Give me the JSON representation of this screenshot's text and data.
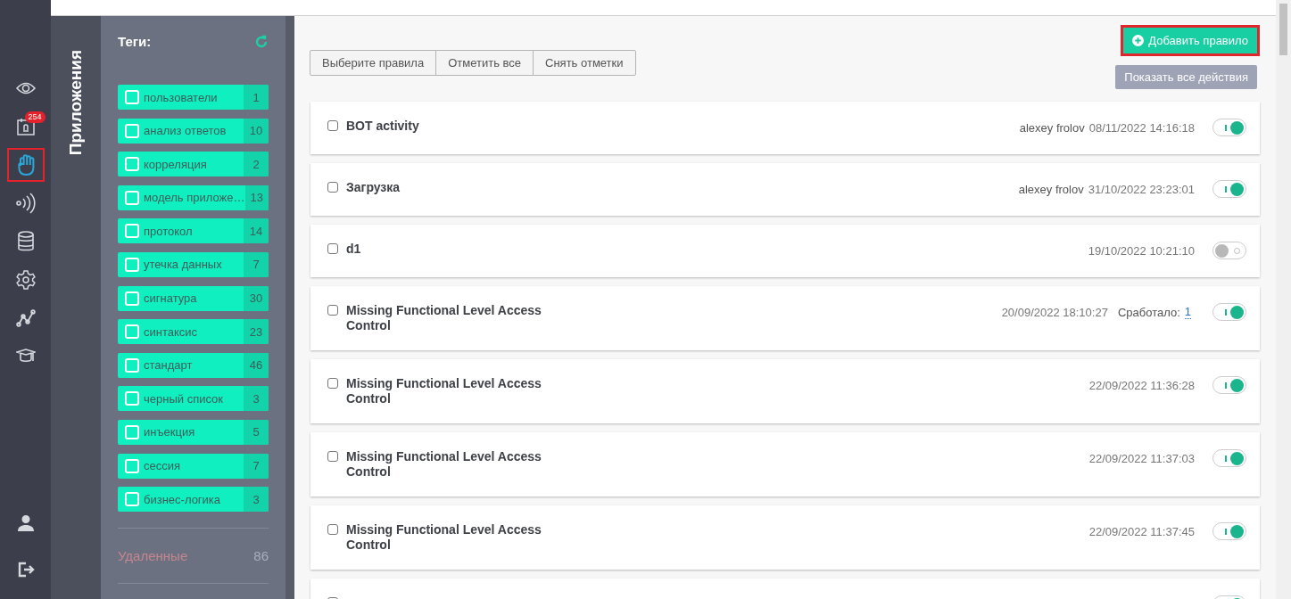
{
  "nav": [
    {
      "kind": "eye",
      "selected": false
    },
    {
      "kind": "alerts",
      "selected": false,
      "badge": "254"
    },
    {
      "kind": "hand",
      "selected": true
    },
    {
      "kind": "signal",
      "selected": false
    },
    {
      "kind": "database",
      "selected": false
    },
    {
      "kind": "gear",
      "selected": false
    },
    {
      "kind": "chart",
      "selected": false
    },
    {
      "kind": "cap",
      "selected": false
    }
  ],
  "nav_bottom": [
    {
      "kind": "user"
    },
    {
      "kind": "logout"
    }
  ],
  "section_title": "Приложения",
  "tags": {
    "title": "Теги:",
    "items": [
      {
        "label": "пользователи",
        "count": "1",
        "checked": false
      },
      {
        "label": "анализ ответов",
        "count": "10",
        "checked": false
      },
      {
        "label": "корреляция",
        "count": "2",
        "checked": false
      },
      {
        "label": "модель приложе…",
        "count": "13",
        "checked": false
      },
      {
        "label": "протокол",
        "count": "14",
        "checked": false
      },
      {
        "label": "утечка данных",
        "count": "7",
        "checked": false
      },
      {
        "label": "сигнатура",
        "count": "30",
        "checked": false
      },
      {
        "label": "синтаксис",
        "count": "23",
        "checked": false
      },
      {
        "label": "стандарт",
        "count": "46",
        "checked": false
      },
      {
        "label": "черный список",
        "count": "3",
        "checked": false
      },
      {
        "label": "инъекция",
        "count": "5",
        "checked": false
      },
      {
        "label": "сессия",
        "count": "7",
        "checked": false
      },
      {
        "label": "бизнес-логика",
        "count": "3",
        "checked": false
      }
    ],
    "deleted": {
      "label": "Удаленные",
      "count": "86"
    }
  },
  "toolbar": [
    "Выберите правила",
    "Отметить все",
    "Снять отметки"
  ],
  "add_button": "Добавить правило",
  "show_actions_button": "Показать все действия",
  "rules": [
    {
      "title": "BOT activity",
      "author": "alexey frolov",
      "datetime": "08/11/2022 14:16:18",
      "checked": false,
      "on": true
    },
    {
      "title": "Загрузка",
      "author": "alexey frolov",
      "datetime": "31/10/2022 23:23:01",
      "checked": false,
      "on": true
    },
    {
      "title": "d1",
      "datetime": "19/10/2022 10:21:10",
      "checked": false,
      "on": false
    },
    {
      "title": "Missing Functional Level Access Control",
      "datetime": "20/09/2022 18:10:27",
      "triggered_label": "Сработало:",
      "triggered_count": "1",
      "checked": false,
      "on": true
    },
    {
      "title": "Missing Functional Level Access Control",
      "datetime": "22/09/2022 11:36:28",
      "checked": false,
      "on": true
    },
    {
      "title": "Missing Functional Level Access Control",
      "datetime": "22/09/2022 11:37:03",
      "checked": false,
      "on": true
    },
    {
      "title": "Missing Functional Level Access Control",
      "datetime": "22/09/2022 11:37:45",
      "checked": false,
      "on": true
    },
    {
      "checked": false,
      "on": true
    }
  ]
}
